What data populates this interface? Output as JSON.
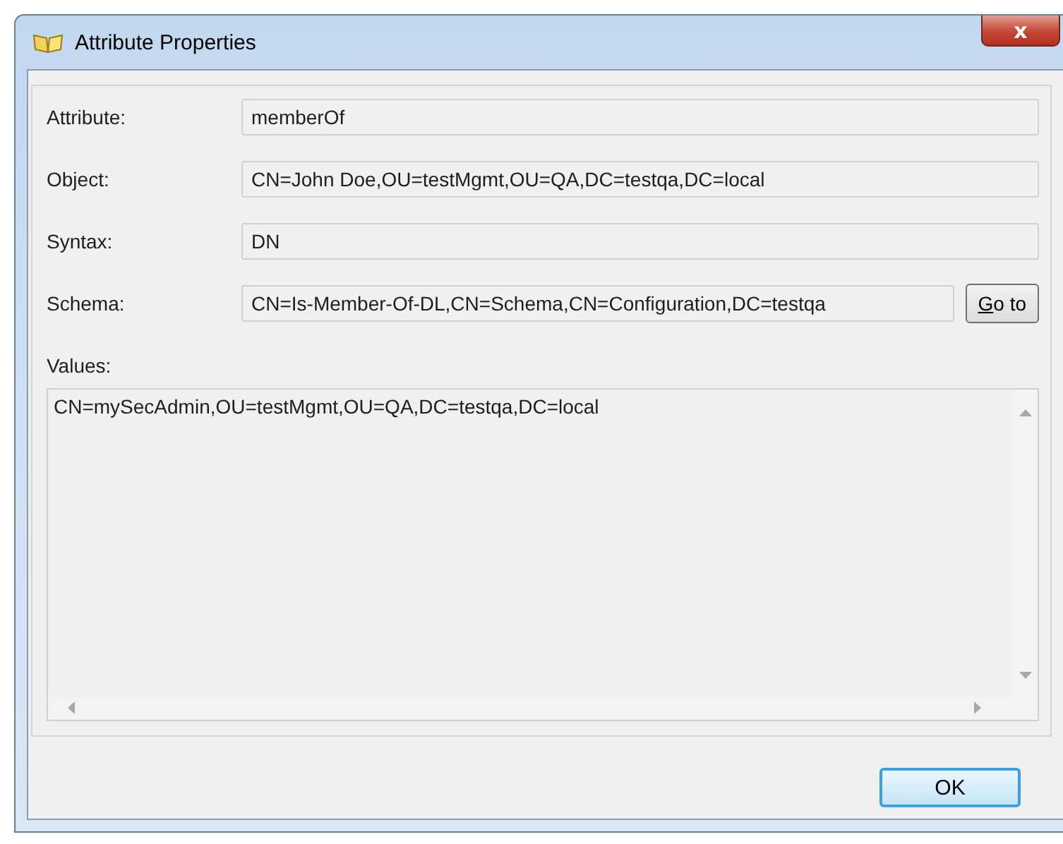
{
  "window": {
    "title": "Attribute Properties",
    "close": "x"
  },
  "fields": [
    {
      "label": "Attribute:",
      "value": "memberOf"
    },
    {
      "label": "Object:",
      "value": "CN=John Doe,OU=testMgmt,OU=QA,DC=testqa,DC=local"
    },
    {
      "label": "Syntax:",
      "value": "DN"
    },
    {
      "label": "Schema:",
      "value": "CN=Is-Member-Of-DL,CN=Schema,CN=Configuration,DC=testqa",
      "button": "Go to"
    }
  ],
  "values": {
    "label": "Values:",
    "items": [
      "CN=mySecAdmin,OU=testMgmt,OU=QA,DC=testqa,DC=local"
    ]
  },
  "buttons": [
    "OK"
  ]
}
